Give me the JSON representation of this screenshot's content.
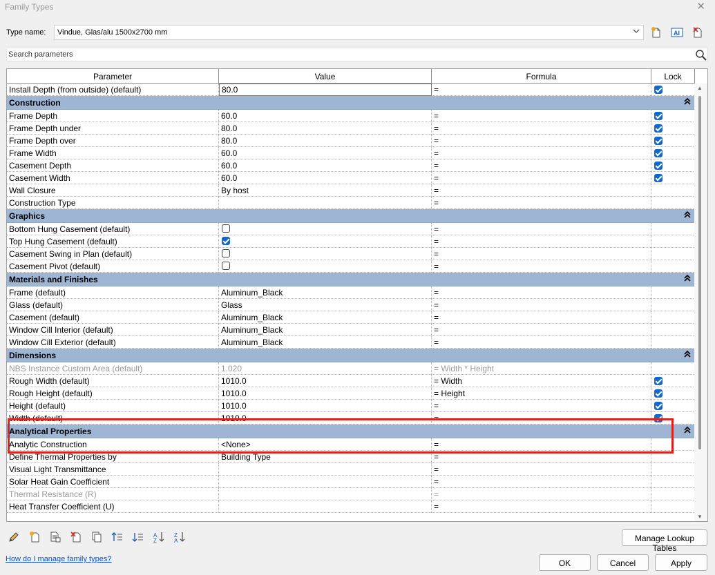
{
  "window": {
    "title": "Family Types",
    "close_glyph": "✕"
  },
  "type_name": {
    "label": "Type name:",
    "value": "Vindue, Glas/alu 1500x2700 mm",
    "icons": [
      "new-type-icon",
      "rename-type-icon",
      "delete-type-icon"
    ]
  },
  "search": {
    "placeholder": "Search parameters",
    "icon": "search-icon"
  },
  "columns": {
    "parameter": "Parameter",
    "value": "Value",
    "formula": "Formula",
    "lock": "Lock"
  },
  "groups": [
    {
      "name": null,
      "rows": [
        {
          "param": "Install Depth (from outside) (default)",
          "value": "80.0",
          "formula": "=",
          "lock": true,
          "editing": true
        }
      ]
    },
    {
      "name": "Construction",
      "rows": [
        {
          "param": "Frame Depth",
          "value": "60.0",
          "formula": "=",
          "lock": true
        },
        {
          "param": "Frame Depth under",
          "value": "80.0",
          "formula": "=",
          "lock": true
        },
        {
          "param": "Frame Depth over",
          "value": "80.0",
          "formula": "=",
          "lock": true
        },
        {
          "param": "Frame Width",
          "value": "60.0",
          "formula": "=",
          "lock": true
        },
        {
          "param": "Casement Depth",
          "value": "60.0",
          "formula": "=",
          "lock": true
        },
        {
          "param": "Casement Width",
          "value": "60.0",
          "formula": "=",
          "lock": true
        },
        {
          "param": "Wall Closure",
          "value": "By host",
          "formula": "=",
          "lock": null
        },
        {
          "param": "Construction Type",
          "value": "",
          "formula": "=",
          "lock": null
        }
      ]
    },
    {
      "name": "Graphics",
      "rows": [
        {
          "param": "Bottom Hung Casement (default)",
          "checkbox": false,
          "formula": "=",
          "lock": null
        },
        {
          "param": "Top Hung Casement (default)",
          "checkbox": true,
          "formula": "=",
          "lock": null
        },
        {
          "param": "Casement Swing in Plan (default)",
          "checkbox": false,
          "formula": "=",
          "lock": null
        },
        {
          "param": "Casement Pivot (default)",
          "checkbox": false,
          "formula": "=",
          "lock": null
        }
      ]
    },
    {
      "name": "Materials and Finishes",
      "rows": [
        {
          "param": "Frame (default)",
          "value": "Aluminum_Black",
          "formula": "=",
          "lock": null
        },
        {
          "param": "Glass (default)",
          "value": "Glass",
          "formula": "=",
          "lock": null
        },
        {
          "param": "Casement (default)",
          "value": "Aluminum_Black",
          "formula": "=",
          "lock": null
        },
        {
          "param": "Window Cill Interior (default)",
          "value": "Aluminum_Black",
          "formula": "=",
          "lock": null
        },
        {
          "param": "Window Cill Exterior (default)",
          "value": "Aluminum_Black",
          "formula": "=",
          "lock": null
        }
      ]
    },
    {
      "name": "Dimensions",
      "rows": [
        {
          "param": "NBS Instance Custom Area (default)",
          "value": "1.020",
          "formula": "= Width * Height",
          "lock": null,
          "gray": true
        },
        {
          "param": "Rough Width (default)",
          "value": "1010.0",
          "formula": "= Width",
          "lock": true
        },
        {
          "param": "Rough Height (default)",
          "value": "1010.0",
          "formula": "= Height",
          "lock": true
        },
        {
          "param": "Height (default)",
          "value": "1010.0",
          "formula": "=",
          "lock": true
        },
        {
          "param": "Width (default)",
          "value": "1010.0",
          "formula": "=",
          "lock": true
        }
      ]
    },
    {
      "name": "Analytical Properties",
      "rows": [
        {
          "param": "Analytic Construction",
          "value": "<None>",
          "formula": "=",
          "lock": null
        },
        {
          "param": "Define Thermal Properties by",
          "value": "Building Type",
          "formula": "=",
          "lock": null
        },
        {
          "param": "Visual Light Transmittance",
          "value": "",
          "formula": "=",
          "lock": null
        },
        {
          "param": "Solar Heat Gain Coefficient",
          "value": "",
          "formula": "=",
          "lock": null
        },
        {
          "param": "Thermal Resistance (R)",
          "value": "",
          "formula": "=",
          "lock": null,
          "gray": true
        },
        {
          "param": "Heat Transfer Coefficient (U)",
          "value": "",
          "formula": "=",
          "lock": null
        }
      ]
    }
  ],
  "collapse_glyph": "≈",
  "bottom_tools": [
    "edit-parameter-icon",
    "new-parameter-icon",
    "delete-parameter-icon",
    "remove-parameter-icon",
    "copy-parameter-icon",
    "move-up-icon",
    "move-down-icon",
    "sort-ascending-icon",
    "sort-descending-icon"
  ],
  "buttons": {
    "lookup": "Manage Lookup Tables",
    "ok": "OK",
    "cancel": "Cancel",
    "apply": "Apply"
  },
  "help_link": "How do I manage family types?",
  "colors": {
    "group_header": "#9fb5d4",
    "checkbox_on": "#1468c9",
    "highlight": "#e0221f",
    "link": "#0b4fd0"
  }
}
